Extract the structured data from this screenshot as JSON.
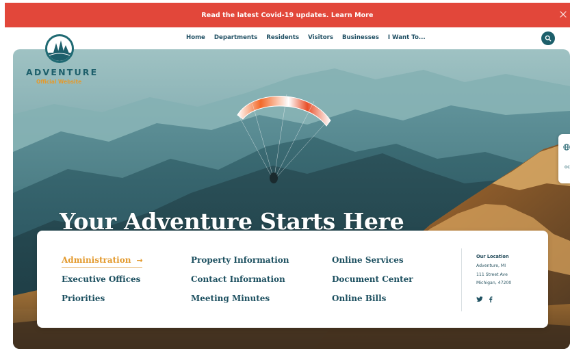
{
  "alert": {
    "text": "Read the latest Covid-19 updates. Learn More",
    "close_icon": "close-icon"
  },
  "logo": {
    "name": "ADVENTURE",
    "subtitle": "Official Website",
    "icon": "pine-trees-icon"
  },
  "nav": {
    "items": [
      {
        "label": "Home"
      },
      {
        "label": "Departments"
      },
      {
        "label": "Residents"
      },
      {
        "label": "Visitors"
      },
      {
        "label": "Businesses"
      },
      {
        "label": "I Want To..."
      }
    ],
    "search_icon": "search-icon"
  },
  "hero": {
    "title": "Your Adventure Starts Here"
  },
  "side_widget": {
    "icon": "globe-icon",
    "mark": "oc"
  },
  "quick_links": {
    "columns": [
      [
        {
          "label": "Administration",
          "active": true
        },
        {
          "label": "Executive Offices"
        },
        {
          "label": "Priorities"
        }
      ],
      [
        {
          "label": "Property Information"
        },
        {
          "label": "Contact Information"
        },
        {
          "label": "Meeting Minutes"
        }
      ],
      [
        {
          "label": "Online Services"
        },
        {
          "label": "Document Center"
        },
        {
          "label": "Online Bills"
        }
      ]
    ],
    "arrow_icon": "arrow-right-icon"
  },
  "location": {
    "title": "Our Location",
    "lines": [
      "Adventure, MI",
      "111 Street Ave",
      "Michigan, 47200"
    ]
  },
  "social": {
    "icons": [
      "twitter-icon",
      "facebook-icon"
    ]
  },
  "colors": {
    "alert": "#e2473a",
    "brand": "#1d5f6b",
    "accent": "#e39a2e",
    "link": "#1d5060"
  }
}
